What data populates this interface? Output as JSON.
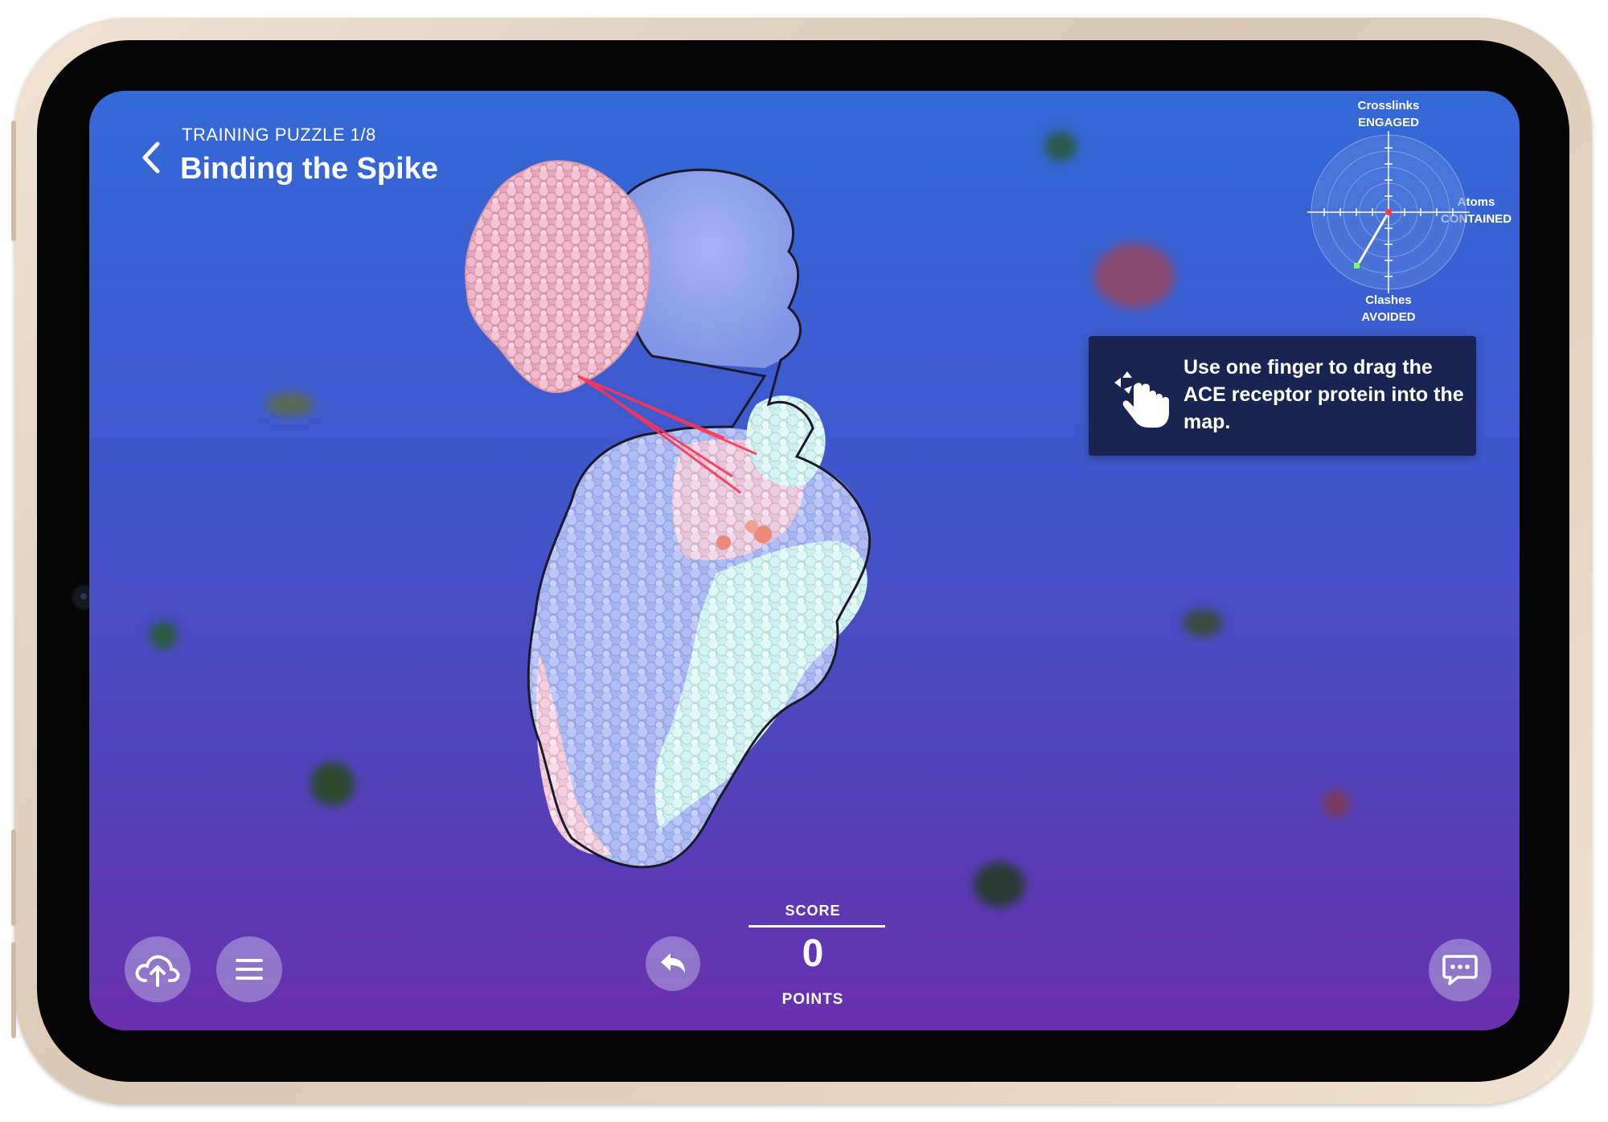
{
  "header": {
    "label": "TRAINING PUZZLE 1/8",
    "title": "Binding the Spike",
    "back_icon": "chevron-left-icon"
  },
  "radar": {
    "top_label_1": "Crosslinks",
    "top_label_2": "ENGAGED",
    "right_label_1": "Atoms",
    "right_label_2": "CONTAINED",
    "bottom_label_1": "Clashes",
    "bottom_label_2": "AVOIDED"
  },
  "hint": {
    "text": "Use one finger to drag the ACE receptor protein into the map.",
    "icon": "drag-gesture-icon"
  },
  "toolbar": {
    "upload_icon": "cloud-upload-icon",
    "menu_icon": "menu-icon",
    "undo_icon": "undo-icon",
    "chat_icon": "chat-icon"
  },
  "score": {
    "label": "SCORE",
    "value": "0",
    "unit": "POINTS"
  },
  "colors": {
    "background_top": "#3469d6",
    "background_bottom": "#6a2fae",
    "hint_background": "#1a2452",
    "crosslink": "#ff3355",
    "ace_protein": "#f2b3c7",
    "map_surface": "#9aaaf0"
  }
}
